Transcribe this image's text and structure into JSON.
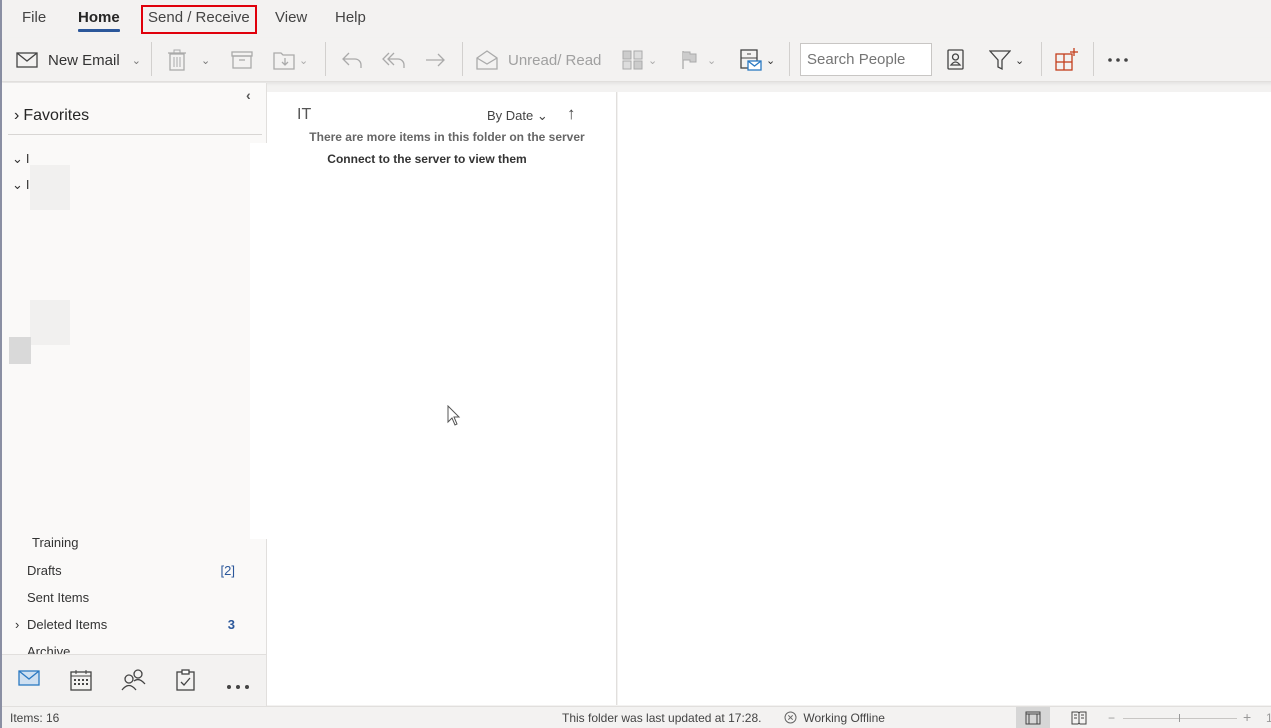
{
  "menu": {
    "tabs": [
      {
        "label": "File",
        "active": false
      },
      {
        "label": "Home",
        "active": true
      },
      {
        "label": "Send / Receive",
        "active": false,
        "highlighted": true
      },
      {
        "label": "View",
        "active": false
      },
      {
        "label": "Help",
        "active": false
      }
    ]
  },
  "ribbon": {
    "new_email": "New Email",
    "unread_read": "Unread/ Read",
    "search_people_placeholder": "Search People",
    "icons": [
      "mail-icon",
      "delete-icon",
      "archive-icon",
      "move-icon",
      "reply-icon",
      "reply-all-icon",
      "forward-icon",
      "envelope-open-icon",
      "categorize-icon",
      "flag-icon",
      "rules-icon",
      "address-book-icon",
      "filter-icon",
      "apps-icon",
      "more-icon"
    ]
  },
  "folder_pane": {
    "favorites": "Favorites",
    "accounts": [
      {
        "label": "I"
      },
      {
        "label": "I"
      }
    ],
    "folders": [
      {
        "label": "Training",
        "count": ""
      },
      {
        "label": "Drafts",
        "count": "[2]"
      },
      {
        "label": "Sent Items",
        "count": ""
      },
      {
        "label": "Deleted Items",
        "count": "3",
        "expandable": true
      },
      {
        "label": "Archive",
        "count": ""
      }
    ],
    "collapse_glyph": "‹"
  },
  "nav": {
    "items": [
      "mail",
      "calendar",
      "people",
      "tasks",
      "more"
    ]
  },
  "message_list": {
    "folder_title": "IT",
    "sort_label": "By Date",
    "sort_direction": "↑",
    "server_message": "There are more items in this folder on the server",
    "server_link": "Connect to the server to view them"
  },
  "status": {
    "items": "Items: 16",
    "last_updated": "This folder was last updated at 17:28.",
    "connection": "Working Offline",
    "zoom_minus": "−",
    "zoom_plus": "+",
    "zoom_value": "1"
  },
  "colors": {
    "accent": "#2b579a",
    "highlight_box": "#e0000b",
    "apps_icon": "#c43e1c"
  }
}
